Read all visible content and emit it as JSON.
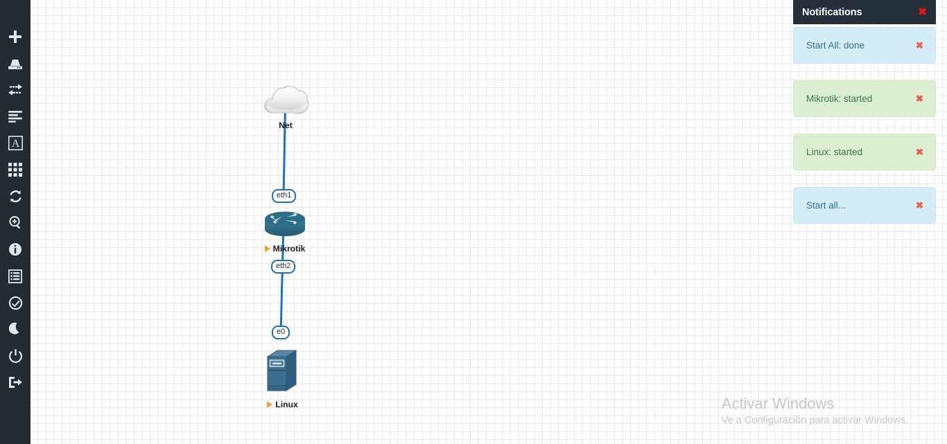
{
  "sidebar": {
    "items": [
      {
        "name": "add-node-tool",
        "icon": "plus-icon",
        "title": "Add node"
      },
      {
        "name": "add-network-tool",
        "icon": "network-cloud-icon",
        "title": "Add network"
      },
      {
        "name": "add-link-tool",
        "icon": "link-arrows-icon",
        "title": "Add link"
      },
      {
        "name": "notes-tool",
        "icon": "lines-icon",
        "title": "Notes"
      },
      {
        "name": "text-tool",
        "icon": "text-a-icon",
        "title": "Add text"
      },
      {
        "name": "grid-tool",
        "icon": "grid-icon",
        "title": "Grid"
      },
      {
        "name": "refresh-tool",
        "icon": "refresh-icon",
        "title": "Refresh"
      },
      {
        "name": "zoom-tool",
        "icon": "magnifier-plus-icon",
        "title": "Zoom"
      },
      {
        "name": "info-tool",
        "icon": "info-circle-icon",
        "title": "Info"
      },
      {
        "name": "list-tool",
        "icon": "list-panel-icon",
        "title": "List"
      },
      {
        "name": "status-tool",
        "icon": "check-circle-icon",
        "title": "Status"
      },
      {
        "name": "night-mode-tool",
        "icon": "moon-icon",
        "title": "Night mode"
      },
      {
        "name": "power-tool",
        "icon": "power-icon",
        "title": "Power"
      },
      {
        "name": "logout-tool",
        "icon": "logout-icon",
        "title": "Log out"
      }
    ]
  },
  "notifications": {
    "title": "Notifications",
    "close_label": "✖",
    "items": [
      {
        "text": "Start All: done",
        "type": "info",
        "close_label": "✖"
      },
      {
        "text": "Mikrotik: started",
        "type": "success",
        "close_label": "✖"
      },
      {
        "text": "Linux: started",
        "type": "success",
        "close_label": "✖"
      },
      {
        "text": "Start all...",
        "type": "info",
        "close_label": "✖"
      }
    ]
  },
  "topology": {
    "nodes": [
      {
        "id": "net",
        "label": "Net",
        "type": "cloud",
        "running": false
      },
      {
        "id": "mikrotik",
        "label": "Mikrotik",
        "type": "router",
        "running": true
      },
      {
        "id": "linux",
        "label": "Linux",
        "type": "server",
        "running": true
      }
    ],
    "interfaces": [
      {
        "id": "eth1",
        "label": "eth1",
        "node": "mikrotik"
      },
      {
        "id": "eth2",
        "label": "eth2",
        "node": "mikrotik"
      },
      {
        "id": "e0",
        "label": "e0",
        "node": "linux"
      }
    ],
    "links": [
      {
        "from": "net",
        "to": "mikrotik"
      },
      {
        "from": "mikrotik",
        "to": "linux"
      }
    ],
    "link_color": "#1f6fb4"
  },
  "watermark": {
    "title": "Activar Windows",
    "subtitle": "Ve a Configuración para activar Windows."
  },
  "colors": {
    "sidebar_bg": "#232b30",
    "notif_header_bg": "#252f3a",
    "info_bg": "#d4edf9",
    "info_text": "#31708f",
    "success_bg": "#dcefd3",
    "success_text": "#3c763d",
    "close_red": "#e8161b",
    "link_blue": "#1f6fb4",
    "router_blue": "#2e6d89",
    "server_blue": "#3d6e8f",
    "play_orange": "#e8a33d"
  }
}
